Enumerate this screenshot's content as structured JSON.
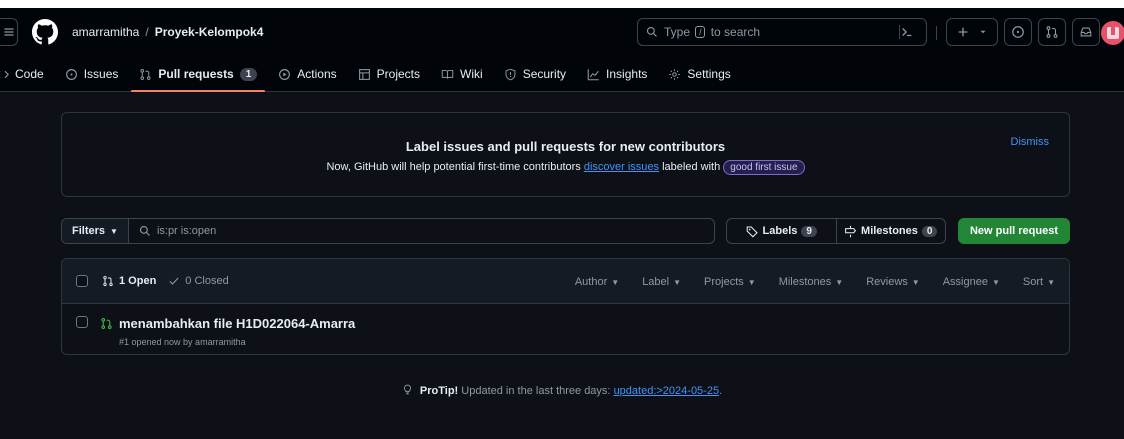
{
  "repo": {
    "owner": "amarramitha",
    "separator": "/",
    "name": "Proyek-Kelompok4"
  },
  "search": {
    "prefix": "Type",
    "key": "/",
    "suffix": "to search"
  },
  "tabs": [
    {
      "label": "Code",
      "icon": "code-icon"
    },
    {
      "label": "Issues",
      "icon": "issue-opened-icon"
    },
    {
      "label": "Pull requests",
      "icon": "git-pull-request-icon",
      "count": "1",
      "selected": true
    },
    {
      "label": "Actions",
      "icon": "play-icon"
    },
    {
      "label": "Projects",
      "icon": "table-icon"
    },
    {
      "label": "Wiki",
      "icon": "book-icon"
    },
    {
      "label": "Security",
      "icon": "shield-icon"
    },
    {
      "label": "Insights",
      "icon": "graph-icon"
    },
    {
      "label": "Settings",
      "icon": "gear-icon"
    }
  ],
  "banner": {
    "title": "Label issues and pull requests for new contributors",
    "desc_before": "Now, GitHub will help potential first-time contributors",
    "desc_link": "discover issues",
    "desc_middle": "labeled with",
    "label_chip": "good first issue",
    "dismiss": "Dismiss"
  },
  "toolbar": {
    "filters": "Filters",
    "filter_query": "is:pr is:open",
    "labels": "Labels",
    "labels_count": "9",
    "milestones": "Milestones",
    "milestones_count": "0",
    "new_pr": "New pull request"
  },
  "list": {
    "open": "1 Open",
    "closed": "0 Closed",
    "filters": [
      "Author",
      "Label",
      "Projects",
      "Milestones",
      "Reviews",
      "Assignee",
      "Sort"
    ],
    "items": [
      {
        "title": "menambahkan file H1D022064-Amarra",
        "meta": "#1 opened now by amarramitha"
      }
    ]
  },
  "protip": {
    "label": "ProTip!",
    "text": "Updated in the last three days:",
    "link": "updated:>2024-05-25",
    "end": "."
  },
  "colors": {
    "accent": "#f78166",
    "link": "#4493f8",
    "green": "#238636",
    "open": "#3fb950",
    "bg": "#0d1117"
  }
}
